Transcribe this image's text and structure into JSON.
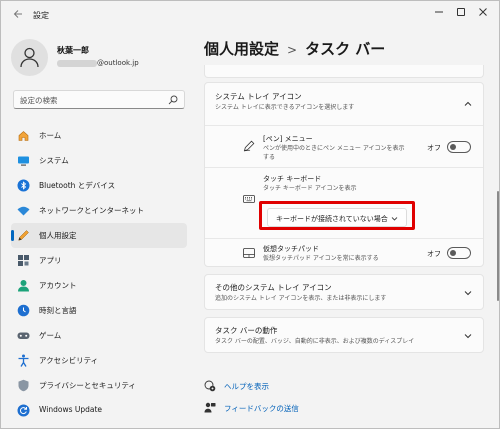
{
  "window": {
    "title": "設定"
  },
  "user": {
    "name": "秋葉一郎",
    "email_suffix": "@outlook.jp"
  },
  "search": {
    "placeholder": "設定の検索"
  },
  "sidebar": {
    "items": [
      {
        "label": "ホーム",
        "icon": "home-icon",
        "active": false
      },
      {
        "label": "システム",
        "icon": "system-icon",
        "active": false
      },
      {
        "label": "Bluetooth とデバイス",
        "icon": "bluetooth-icon",
        "active": false
      },
      {
        "label": "ネットワークとインターネット",
        "icon": "wifi-icon",
        "active": false
      },
      {
        "label": "個人用設定",
        "icon": "pen-icon",
        "active": true
      },
      {
        "label": "アプリ",
        "icon": "apps-icon",
        "active": false
      },
      {
        "label": "アカウント",
        "icon": "account-icon",
        "active": false
      },
      {
        "label": "時刻と言語",
        "icon": "time-language-icon",
        "active": false
      },
      {
        "label": "ゲーム",
        "icon": "gamepad-icon",
        "active": false
      },
      {
        "label": "アクセシビリティ",
        "icon": "accessibility-icon",
        "active": false
      },
      {
        "label": "プライバシーとセキュリティ",
        "icon": "shield-icon",
        "active": false
      },
      {
        "label": "Windows Update",
        "icon": "update-icon",
        "active": false
      }
    ]
  },
  "breadcrumb": {
    "parent": "個人用設定",
    "separator": ">",
    "current": "タスク バー"
  },
  "tray": {
    "title": "システム トレイ アイコン",
    "subtitle": "システム トレイに表示できるアイコンを選択します",
    "pen_menu": {
      "title": "[ペン] メニュー",
      "subtitle": "ペンが使用中のときにペン メニュー アイコンを表示する",
      "toggle_label": "オフ"
    },
    "touch_keyboard": {
      "title": "タッチ キーボード",
      "subtitle": "タッチ キーボード アイコンを表示",
      "dropdown_value": "キーボードが接続されていない場合"
    },
    "virtual_touchpad": {
      "title": "仮想タッチパッド",
      "subtitle": "仮想タッチパッド アイコンを常に表示する",
      "toggle_label": "オフ"
    }
  },
  "other_tray": {
    "title": "その他のシステム トレイ アイコン",
    "subtitle": "追加のシステム トレイ アイコンを表示、または非表示にします"
  },
  "taskbar_behavior": {
    "title": "タスク バーの動作",
    "subtitle": "タスク バーの配置、バッジ、自動的に非表示、および複数のディスプレイ"
  },
  "links": {
    "help": "ヘルプを表示",
    "feedback": "フィードバックの送信"
  },
  "colors": {
    "accent": "#0067c0",
    "highlight": "#e00000",
    "link": "#0060b8"
  }
}
